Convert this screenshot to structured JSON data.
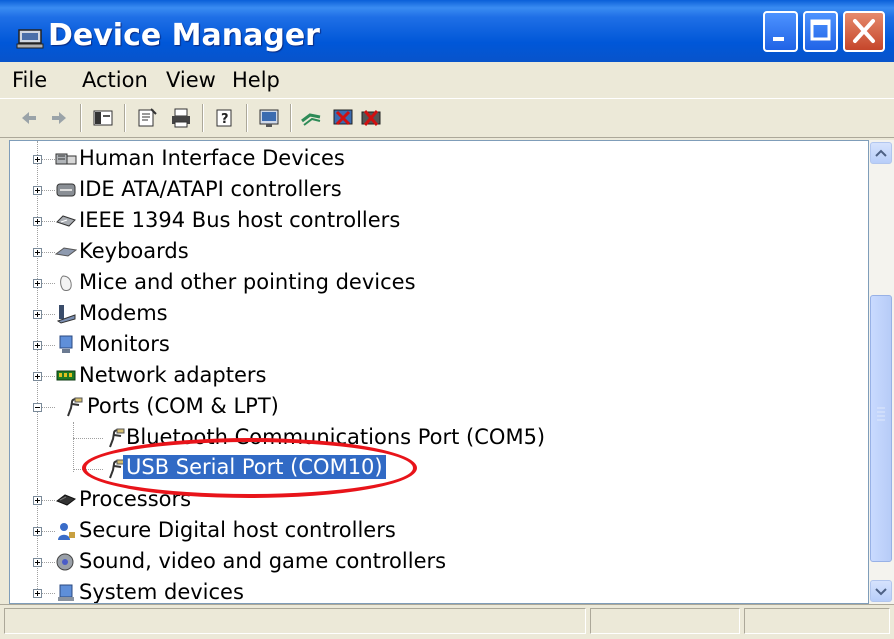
{
  "window": {
    "title": "Device Manager",
    "controls": {
      "minimize": "minimize",
      "maximize": "maximize",
      "close": "close"
    }
  },
  "menu": [
    "File",
    "Action",
    "View",
    "Help"
  ],
  "toolbar": {
    "icons": [
      "back-icon",
      "forward-icon",
      "show-hide-console-tree-icon",
      "properties-icon",
      "print-icon",
      "help-icon",
      "scan-hardware-icon",
      "update-driver-icon",
      "disable-device-icon",
      "uninstall-device-icon"
    ]
  },
  "tree": [
    {
      "label": "Human Interface Devices",
      "icon": "hid-icon",
      "expanded": false
    },
    {
      "label": "IDE ATA/ATAPI controllers",
      "icon": "ide-icon",
      "expanded": false
    },
    {
      "label": "IEEE 1394 Bus host controllers",
      "icon": "ieee1394-icon",
      "expanded": false
    },
    {
      "label": "Keyboards",
      "icon": "keyboard-icon",
      "expanded": false
    },
    {
      "label": "Mice and other pointing devices",
      "icon": "mouse-icon",
      "expanded": false
    },
    {
      "label": "Modems",
      "icon": "modem-icon",
      "expanded": false
    },
    {
      "label": "Monitors",
      "icon": "monitor-icon",
      "expanded": false
    },
    {
      "label": "Network adapters",
      "icon": "network-adapter-icon",
      "expanded": false
    },
    {
      "label": "Ports (COM & LPT)",
      "icon": "port-icon",
      "expanded": true,
      "children": [
        {
          "label": "Bluetooth Communications Port (COM5)",
          "icon": "port-icon"
        },
        {
          "label": "USB Serial Port (COM10)",
          "icon": "port-icon",
          "selected": true
        }
      ]
    },
    {
      "label": "Processors",
      "icon": "processor-icon",
      "expanded": false
    },
    {
      "label": "Secure Digital host controllers",
      "icon": "sd-controller-icon",
      "expanded": false
    },
    {
      "label": "Sound, video and game controllers",
      "icon": "sound-icon",
      "expanded": false
    },
    {
      "label": "System devices",
      "icon": "system-devices-icon",
      "expanded": false
    }
  ],
  "annotation": {
    "color": "#e8141a",
    "target": "USB Serial Port (COM10)"
  },
  "colors": {
    "selection": "#316ac5",
    "titlebar": "#0a53c8",
    "chrome": "#ece9d8"
  }
}
